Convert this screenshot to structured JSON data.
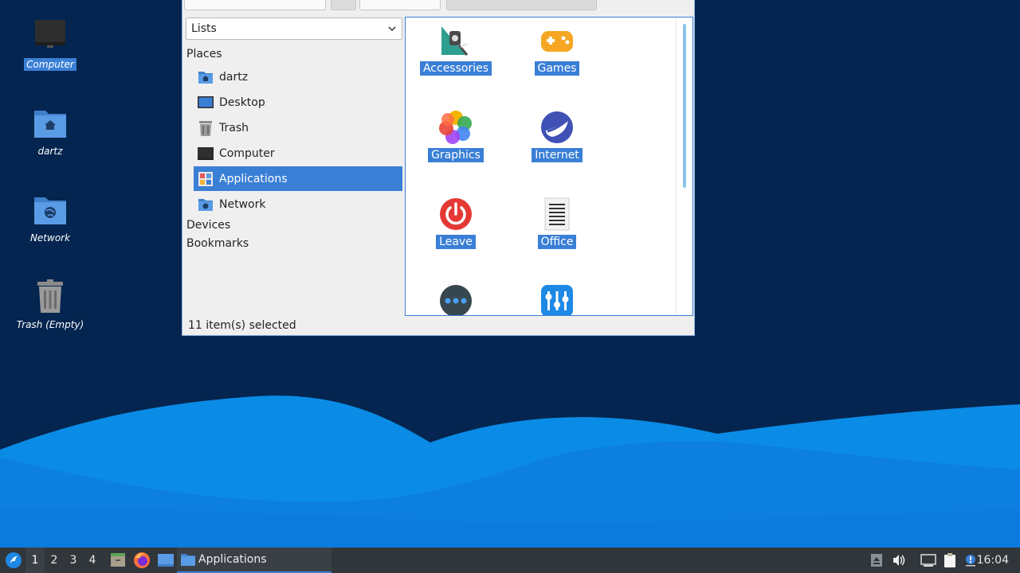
{
  "desktop": {
    "icons": [
      {
        "label": "Computer",
        "icon": "computer-icon"
      },
      {
        "label": "dartz",
        "icon": "home-folder-icon"
      },
      {
        "label": "Network",
        "icon": "network-folder-icon"
      },
      {
        "label": "Trash (Empty)",
        "icon": "trash-icon"
      }
    ]
  },
  "file_manager": {
    "side_pane_mode": "Lists",
    "places_header": "Places",
    "places": [
      {
        "label": "dartz",
        "icon": "home-folder-icon"
      },
      {
        "label": "Desktop",
        "icon": "desktop-icon"
      },
      {
        "label": "Trash",
        "icon": "trash-icon"
      },
      {
        "label": "Computer",
        "icon": "computer-icon"
      },
      {
        "label": "Applications",
        "icon": "applications-icon",
        "selected": true
      },
      {
        "label": "Network",
        "icon": "network-folder-icon"
      }
    ],
    "devices_header": "Devices",
    "bookmarks_header": "Bookmarks",
    "items": [
      {
        "label": "Accessories",
        "icon": "accessories-icon"
      },
      {
        "label": "Games",
        "icon": "games-icon"
      },
      {
        "label": "Graphics",
        "icon": "graphics-icon"
      },
      {
        "label": "Internet",
        "icon": "internet-icon"
      },
      {
        "label": "Leave",
        "icon": "power-icon"
      },
      {
        "label": "Office",
        "icon": "office-icon"
      },
      {
        "label": "",
        "icon": "other-icon"
      },
      {
        "label": "",
        "icon": "preferences-icon"
      }
    ],
    "status": "11 item(s) selected"
  },
  "taskbar": {
    "workspaces": [
      "1",
      "2",
      "3",
      "4"
    ],
    "active_workspace": "1",
    "task_label": "Applications",
    "clock": "16:04"
  },
  "colors": {
    "accent": "#3a7fd6",
    "desktop_bg": "#04254f",
    "taskbar_bg": "#31363b"
  }
}
